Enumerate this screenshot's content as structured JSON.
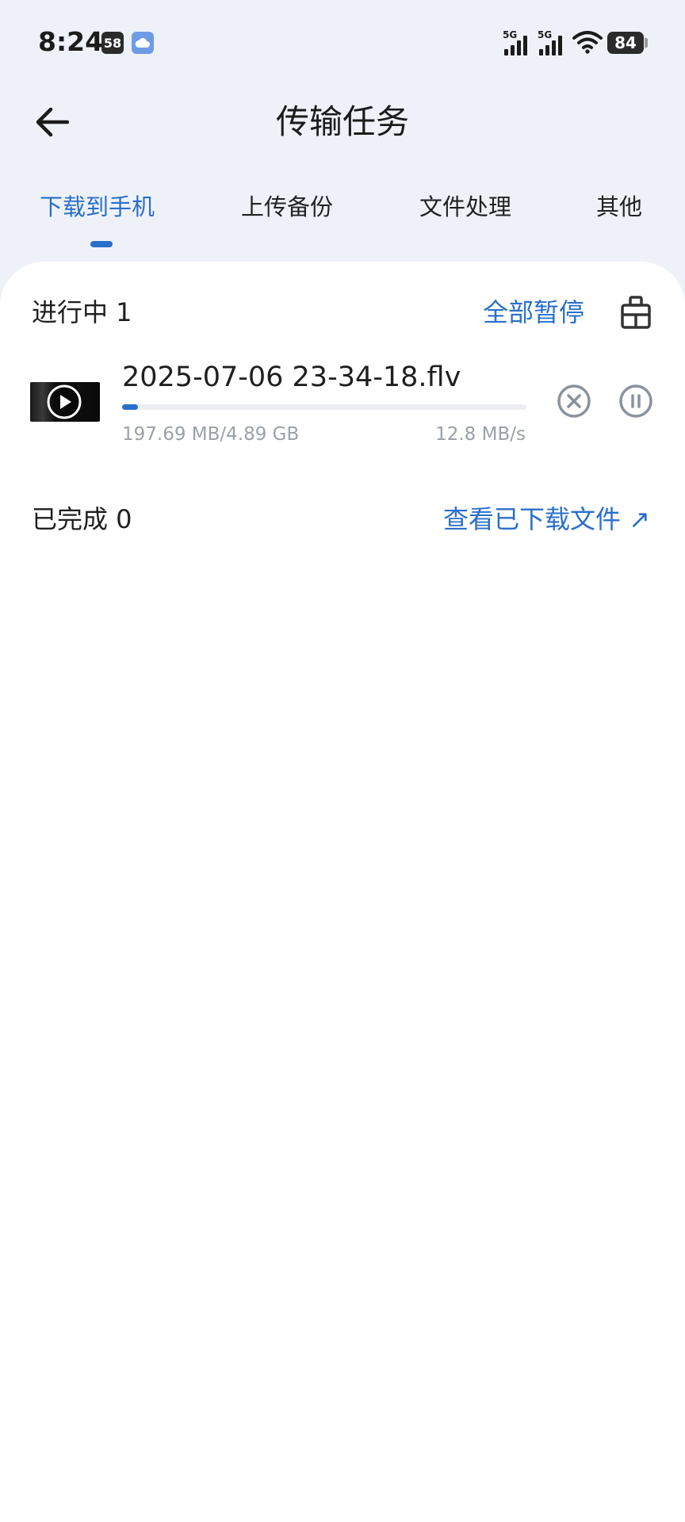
{
  "status_bar": {
    "time": "8:24",
    "notification_count": "58",
    "network_1": "5G",
    "network_2": "5G",
    "battery": "84"
  },
  "header": {
    "title": "传输任务"
  },
  "tabs": [
    {
      "label": "下载到手机",
      "active": true
    },
    {
      "label": "上传备份",
      "active": false
    },
    {
      "label": "文件处理",
      "active": false
    },
    {
      "label": "其他",
      "active": false
    }
  ],
  "in_progress": {
    "title": "进行中 1",
    "pause_all_label": "全部暂停",
    "tasks": [
      {
        "file_name": "2025-07-06 23-34-18.flv",
        "size_progress": "197.69 MB/4.89 GB",
        "speed": "12.8 MB/s",
        "progress_fraction": 0.04
      }
    ]
  },
  "completed": {
    "title": "已完成 0",
    "view_downloads_label": "查看已下载文件 ↗"
  },
  "colors": {
    "accent": "#2a6fc9",
    "background": "#eef2f8",
    "card": "#ffffff",
    "muted_text": "#9aa0a8"
  }
}
